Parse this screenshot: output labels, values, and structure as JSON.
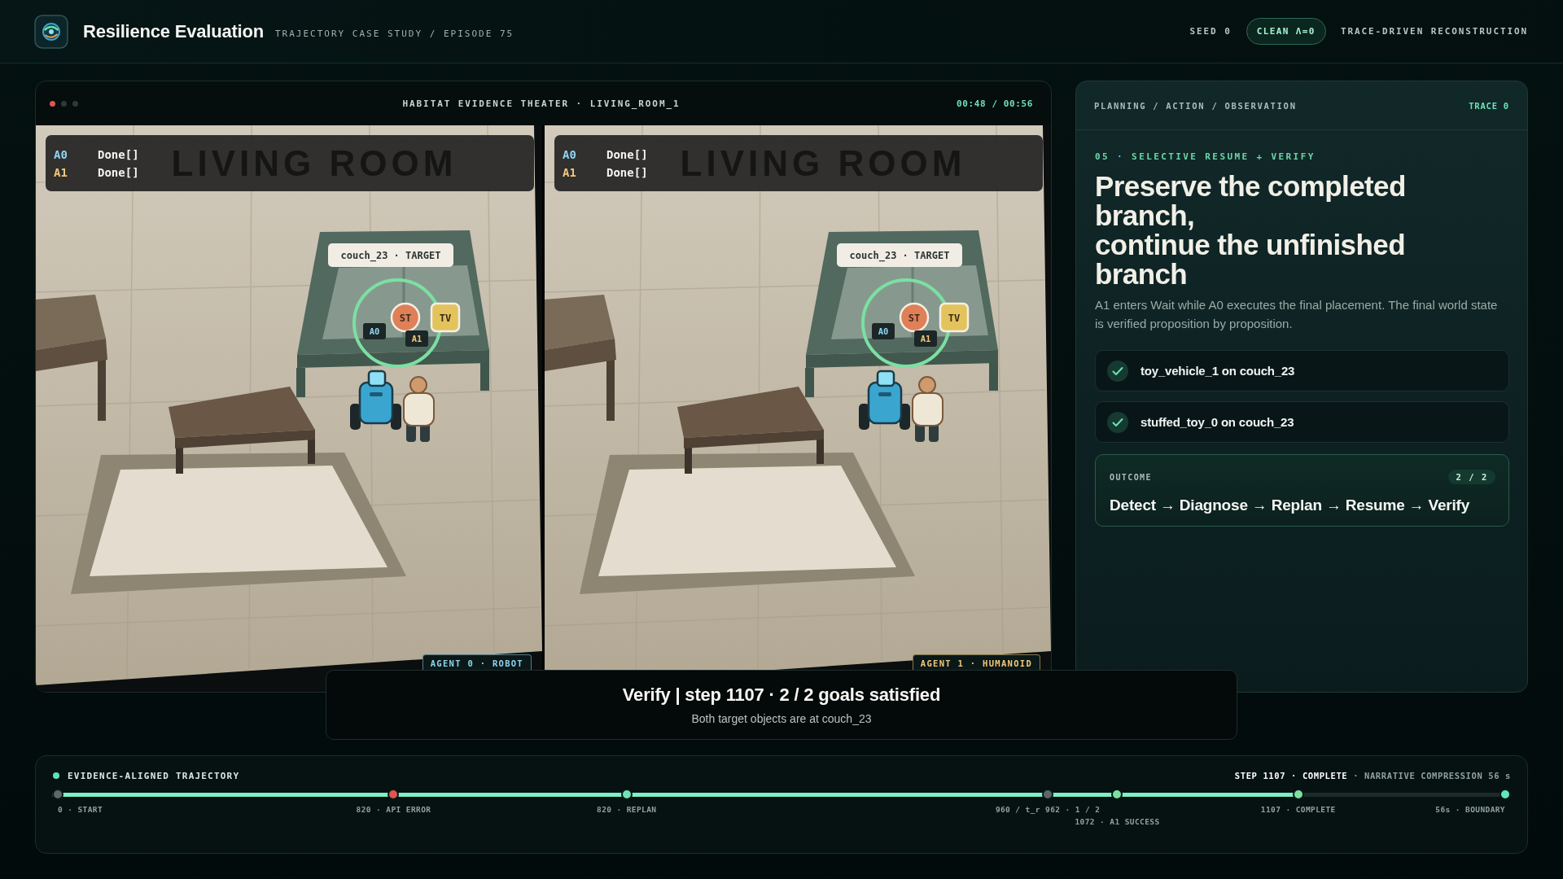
{
  "header": {
    "title": "Resilience Evaluation",
    "subtitle": "TRAJECTORY CASE STUDY / EPISODE 75",
    "seed": "SEED 0",
    "badge": "CLEAN Λ=0",
    "mode": "TRACE-DRIVEN RECONSTRUCTION"
  },
  "theater": {
    "title": "HABITAT EVIDENCE THEATER · LIVING_ROOM_1",
    "time": "00:48 / 00:56",
    "views": [
      {
        "status": [
          {
            "agent": "A0",
            "color": "#8fd3f0",
            "text": "Done[]"
          },
          {
            "agent": "A1",
            "color": "#f2c879",
            "text": "Done[]"
          }
        ],
        "room_label": "LIVING ROOM",
        "target_label": "couch_23 · TARGET",
        "objects": [
          {
            "label": "ST",
            "kind": "round",
            "color": "#df8058"
          },
          {
            "label": "TV",
            "kind": "square",
            "color": "#e3c35c"
          }
        ],
        "agent_tags": [
          {
            "label": "A0",
            "color": "#8fd3f0"
          },
          {
            "label": "A1",
            "color": "#f2c879"
          }
        ],
        "caption": {
          "text": "AGENT 0 · ROBOT",
          "color": "#8fd3f0"
        }
      },
      {
        "status": [
          {
            "agent": "A0",
            "color": "#8fd3f0",
            "text": "Done[]"
          },
          {
            "agent": "A1",
            "color": "#f2c879",
            "text": "Done[]"
          }
        ],
        "room_label": "LIVING ROOM",
        "target_label": "couch_23 · TARGET",
        "objects": [
          {
            "label": "ST",
            "kind": "round",
            "color": "#df8058"
          },
          {
            "label": "TV",
            "kind": "square",
            "color": "#e3c35c"
          }
        ],
        "agent_tags": [
          {
            "label": "A0",
            "color": "#8fd3f0"
          },
          {
            "label": "A1",
            "color": "#f2c879"
          }
        ],
        "caption": {
          "text": "AGENT 1 · HUMANOID",
          "color": "#f2c879"
        }
      }
    ]
  },
  "caption": {
    "title": "Verify | step 1107 · 2 / 2 goals satisfied",
    "subtitle": "Both target objects are at couch_23"
  },
  "panel": {
    "header": "PLANNING / ACTION / OBSERVATION",
    "trace": "TRACE 0",
    "kicker": "05 · SELECTIVE RESUME + VERIFY",
    "heading": "Preserve the completed branch,\ncontinue the unfinished branch",
    "body": "A1 enters Wait while A0 executes the final placement. The final world state is verified proposition by proposition.",
    "checks": [
      {
        "text": "toy_vehicle_1 on couch_23",
        "checked": true
      },
      {
        "text": "stuffed_toy_0 on couch_23",
        "checked": true
      }
    ],
    "outcome": {
      "label": "OUTCOME",
      "count": "2 / 2",
      "flow": "Detect → Diagnose → Replan → Resume → Verify"
    }
  },
  "timeline": {
    "title": "EVIDENCE-ALIGNED TRAJECTORY",
    "summary": "**STEP 1107 · COMPLETE** · NARRATIVE COMPRESSION 56 s",
    "level": 0.857,
    "events": [
      {
        "label": "0 · START",
        "color": "#5c6866"
      },
      {
        "label": "820 · API ERROR",
        "color": "#e0554d"
      },
      {
        "label": "820 · REPLAN",
        "color": "#6fe3b5"
      },
      {
        "label": "960 / t_r 962 · 1 / 2",
        "color": "#5c6866"
      },
      {
        "label": "1072 · A1 SUCCESS",
        "color": "#7ee0a0"
      },
      {
        "label": "1107 · COMPLETE",
        "color": "#7ee0a0"
      },
      {
        "label": "56s · BOUNDARY",
        "color": "#5fe8c0"
      }
    ]
  }
}
